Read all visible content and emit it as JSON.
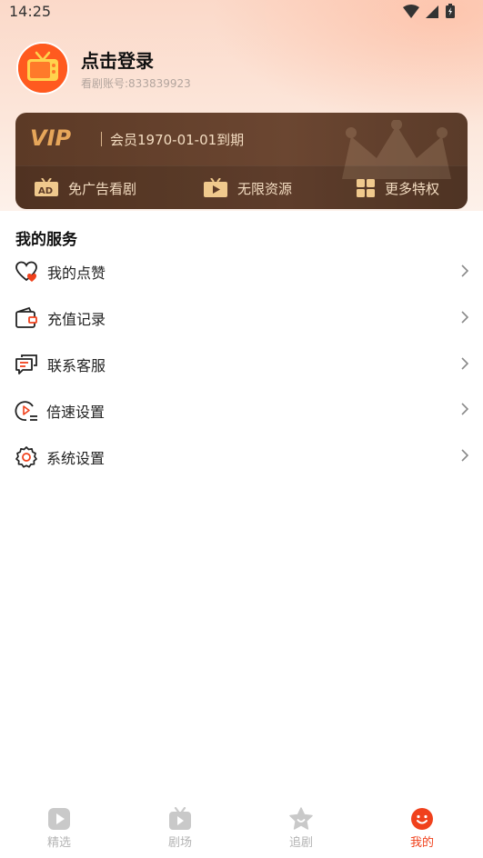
{
  "status_bar": {
    "time": "14:25"
  },
  "profile": {
    "title": "点击登录",
    "account": "看剧账号:833839923"
  },
  "vip": {
    "logo_text": "VIP",
    "expire_text": "会员1970-01-01到期",
    "features": [
      {
        "label": "免广告看剧",
        "icon": "ad-icon"
      },
      {
        "label": "无限资源",
        "icon": "tv-play-icon"
      },
      {
        "label": "更多特权",
        "icon": "grid-icon"
      }
    ]
  },
  "services": {
    "title": "我的服务",
    "items": [
      {
        "label": "我的点赞",
        "icon": "heart-icon"
      },
      {
        "label": "充值记录",
        "icon": "wallet-icon"
      },
      {
        "label": "联系客服",
        "icon": "chat-icon"
      },
      {
        "label": "倍速设置",
        "icon": "speed-play-icon"
      },
      {
        "label": "系统设置",
        "icon": "gear-icon"
      }
    ]
  },
  "tabs": [
    {
      "label": "精选",
      "icon": "play-icon"
    },
    {
      "label": "剧场",
      "icon": "tv-icon"
    },
    {
      "label": "追剧",
      "icon": "star-icon"
    },
    {
      "label": "我的",
      "icon": "smile-icon",
      "active": true
    }
  ],
  "colors": {
    "accent": "#f0411c",
    "vip_card": "#5c3a26",
    "vip_text": "#f3dcc1",
    "vip_gold": "#e6a65a"
  }
}
